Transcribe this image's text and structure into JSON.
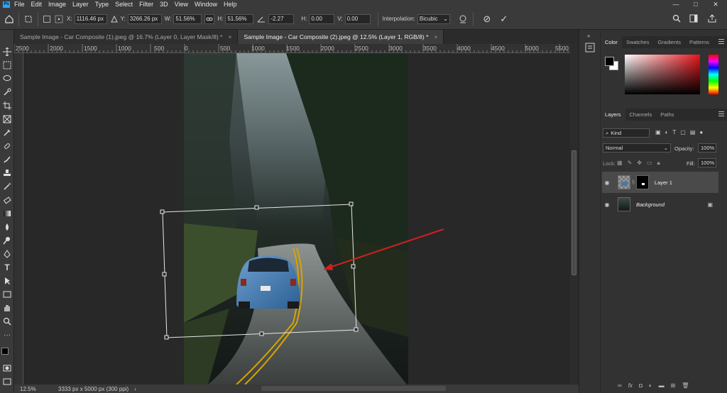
{
  "menubar": {
    "app_icon": "Ps",
    "items": [
      "File",
      "Edit",
      "Image",
      "Layer",
      "Type",
      "Select",
      "Filter",
      "3D",
      "View",
      "Window",
      "Help"
    ],
    "window_controls": {
      "minimize": "—",
      "maximize": "□",
      "close": "✕"
    }
  },
  "options": {
    "x_label": "X:",
    "x_value": "1116.46 px",
    "y_label": "Y:",
    "y_value": "3266.26 px",
    "w_label": "W:",
    "w_value": "51.56%",
    "h_label": "H:",
    "h_value": "51.56%",
    "angle_value": "-2.27",
    "hskew_label": "H:",
    "hskew_value": "0.00",
    "vskew_label": "V:",
    "vskew_value": "0.00",
    "interp_label": "Interpolation:",
    "interp_value": "Bicubic",
    "cancel_icon": "⊘",
    "commit_icon": "✓"
  },
  "tabs": [
    {
      "label": "Sample Image - Car Composite (1).jpeg @ 16.7% (Layer 0, Layer Mask/8) *",
      "active": false
    },
    {
      "label": "Sample Image - Car Composite (2).jpeg @ 12.5% (Layer 1, RGB/8) *",
      "active": true
    }
  ],
  "ruler": {
    "labels": [
      "2500",
      "2000",
      "1500",
      "1000",
      "500",
      "0",
      "500",
      "1000",
      "1500",
      "2000",
      "2500",
      "3000",
      "3500",
      "4000",
      "4500",
      "5000",
      "5500"
    ]
  },
  "status": {
    "zoom": "12.5%",
    "doc_info": "3333 px x 5000 px (300 ppi)"
  },
  "color_panel": {
    "tabs": [
      "Color",
      "Swatches",
      "Gradients",
      "Patterns"
    ],
    "hue_color": "#e8141c"
  },
  "layers_panel": {
    "tabs": [
      "Layers",
      "Channels",
      "Paths"
    ],
    "search_label": "Kind",
    "blend_mode": "Normal",
    "opacity_label": "Opacity:",
    "opacity_value": "100%",
    "lock_label": "Lock:",
    "fill_label": "Fill:",
    "fill_value": "100%",
    "layers": [
      {
        "name": "Layer 1",
        "selected": true
      },
      {
        "name": "Background",
        "selected": false,
        "locked": true
      }
    ],
    "footer_icons": [
      "link-icon",
      "fx-icon",
      "mask-icon",
      "adjustment-icon",
      "folder-icon",
      "new-layer-icon",
      "trash-icon"
    ]
  },
  "icons": {
    "left_tools": [
      "move-icon",
      "marquee-icon",
      "lasso-icon",
      "quick-select-icon",
      "crop-icon",
      "frame-icon",
      "eyedropper-icon",
      "healing-icon",
      "brush-icon",
      "stamp-icon",
      "history-brush-icon",
      "eraser-icon",
      "gradient-icon",
      "blur-icon",
      "dodge-icon",
      "pen-icon",
      "type-icon",
      "path-select-icon",
      "rectangle-icon",
      "hand-icon",
      "zoom-icon",
      "more-icon"
    ]
  }
}
